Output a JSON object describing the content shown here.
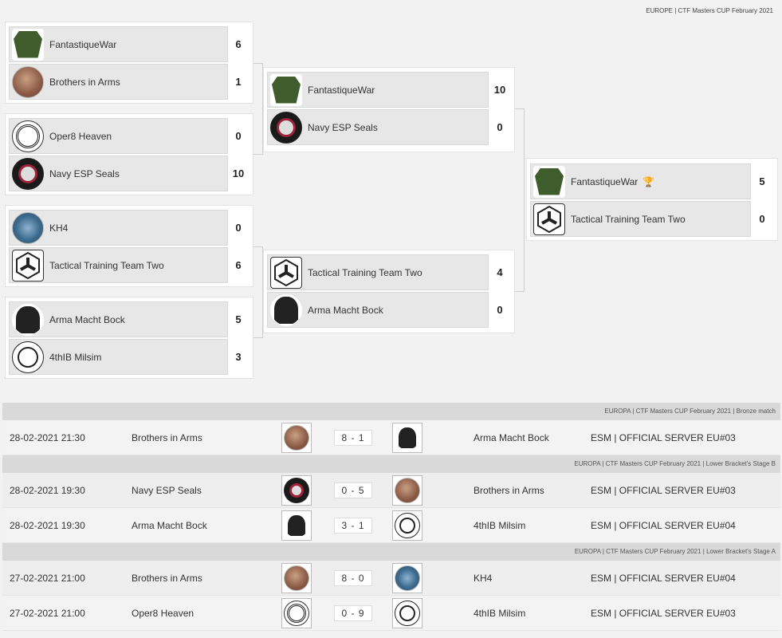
{
  "header": {
    "title": "EUROPE | CTF Masters CUP February 2021"
  },
  "icons": {
    "logo_fantastiquewar": "green-skull-shield-logo",
    "logo_brothers": "brothers-in-arms-portrait-logo",
    "logo_oper8": "oper8-heaven-emblem-logo",
    "logo_navy": "navy-esp-seals-skull-logo",
    "logo_kh4": "kh4-blue-emblem-logo",
    "logo_ttt": "tactical-hexagon-logo",
    "logo_amb": "arma-macht-bock-gorilla-logo",
    "logo_4th": "4thib-cat-logo",
    "trophy": "trophy-icon"
  },
  "bracket": {
    "round1": [
      {
        "team1": "FantastiqueWar",
        "score1": "6",
        "team2": "Brothers in Arms",
        "score2": "1"
      },
      {
        "team1": "Oper8 Heaven",
        "score1": "0",
        "team2": "Navy ESP Seals",
        "score2": "10"
      },
      {
        "team1": "KH4",
        "score1": "0",
        "team2": "Tactical Training Team Two",
        "score2": "6"
      },
      {
        "team1": "Arma Macht Bock",
        "score1": "5",
        "team2": "4thIB Milsim",
        "score2": "3"
      }
    ],
    "round2": [
      {
        "team1": "FantastiqueWar",
        "score1": "10",
        "team2": "Navy ESP Seals",
        "score2": "0"
      },
      {
        "team1": "Tactical Training Team Two",
        "score1": "4",
        "team2": "Arma Macht Bock",
        "score2": "0"
      }
    ],
    "final": {
      "team1": "FantastiqueWar",
      "score1": "5",
      "team2": "Tactical Training Team Two",
      "score2": "0"
    }
  },
  "schedule": [
    {
      "group": "EUROPA | CTF Masters CUP February 2021 | Bronze match",
      "matches": [
        {
          "date": "28-02-2021 21:30",
          "team1": "Brothers in Arms",
          "score": "8 - 1",
          "team2": "Arma Macht Bock",
          "server": "ESM | OFFICIAL SERVER EU#03"
        }
      ]
    },
    {
      "group": "EUROPA | CTF Masters CUP February 2021 | Lower Bracket's Stage B",
      "matches": [
        {
          "date": "28-02-2021 19:30",
          "team1": "Navy ESP Seals",
          "score": "0 - 5",
          "team2": "Brothers in Arms",
          "server": "ESM | OFFICIAL SERVER EU#03"
        },
        {
          "date": "28-02-2021 19:30",
          "team1": "Arma Macht Bock",
          "score": "3 - 1",
          "team2": "4thIB Milsim",
          "server": "ESM | OFFICIAL SERVER EU#04"
        }
      ]
    },
    {
      "group": "EUROPA | CTF Masters CUP February 2021 | Lower Bracket's Stage A",
      "matches": [
        {
          "date": "27-02-2021 21:00",
          "team1": "Brothers in Arms",
          "score": "8 - 0",
          "team2": "KH4",
          "server": "ESM | OFFICIAL SERVER EU#04"
        },
        {
          "date": "27-02-2021 21:00",
          "team1": "Oper8 Heaven",
          "score": "0 - 9",
          "team2": "4thIB Milsim",
          "server": "ESM | OFFICIAL SERVER EU#03"
        }
      ]
    }
  ]
}
